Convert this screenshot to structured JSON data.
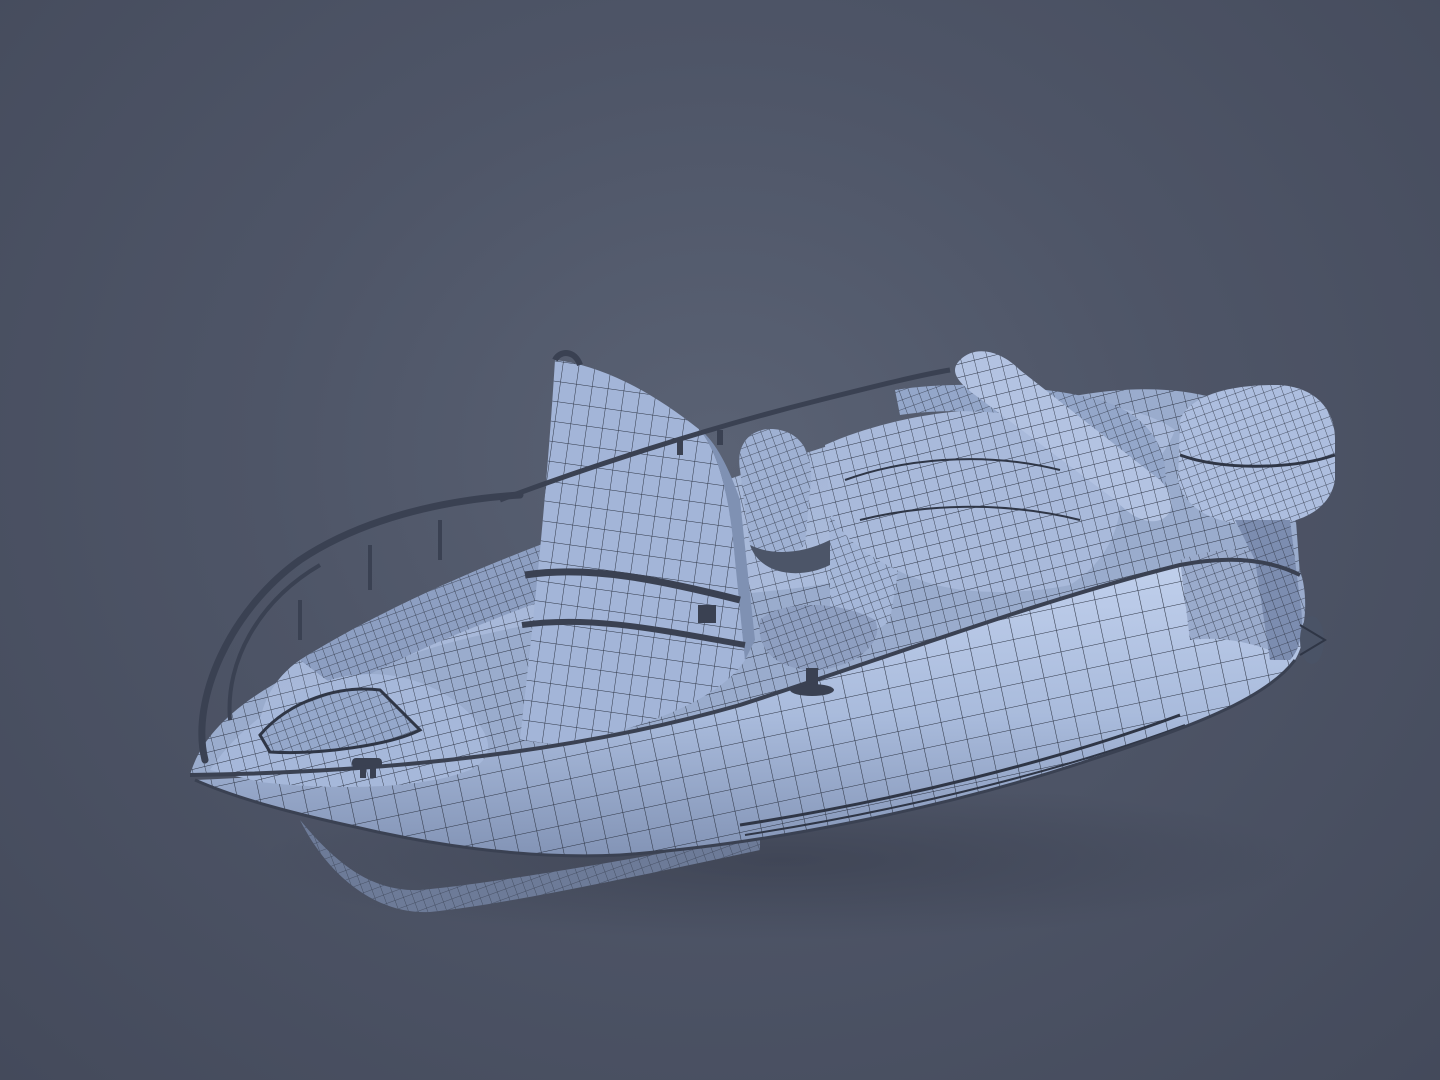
{
  "scene": {
    "subject": "boat-wireframe-render",
    "colors": {
      "background": "#4e5567",
      "hull_light": "#b9c9e6",
      "hull_mid": "#93a6c8",
      "hull_dark": "#6f7f9e",
      "wire": "#2f3646",
      "rail": "#3a4152",
      "shadow": "#3c4252"
    }
  }
}
